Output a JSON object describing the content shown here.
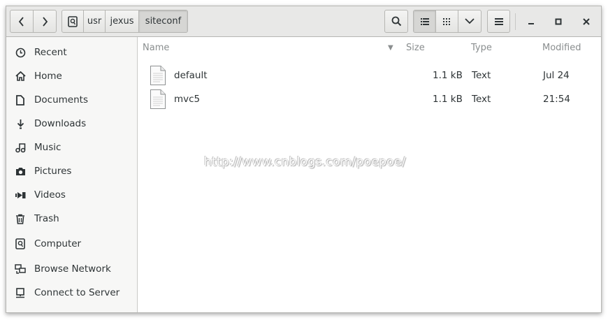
{
  "window": {
    "title": "siteconf"
  },
  "breadcrumb": {
    "root_icon": "drive-icon",
    "segments": [
      "usr",
      "jexus",
      "siteconf"
    ]
  },
  "toolbar": {
    "back_icon": "chevron-left-icon",
    "forward_icon": "chevron-right-icon",
    "search_icon": "search-icon",
    "list_view_icon": "list-view-icon",
    "grid_view_icon": "grid-view-icon",
    "view_options_icon": "chevron-down-icon",
    "menu_icon": "hamburger-icon"
  },
  "window_controls": {
    "minimize": "–",
    "maximize": "□",
    "close": "×"
  },
  "sidebar": {
    "items": [
      {
        "label": "Recent",
        "icon": "clock-icon"
      },
      {
        "label": "Home",
        "icon": "home-icon"
      },
      {
        "label": "Documents",
        "icon": "document-icon"
      },
      {
        "label": "Downloads",
        "icon": "download-icon"
      },
      {
        "label": "Music",
        "icon": "music-icon"
      },
      {
        "label": "Pictures",
        "icon": "camera-icon"
      },
      {
        "label": "Videos",
        "icon": "video-icon"
      },
      {
        "label": "Trash",
        "icon": "trash-icon"
      },
      {
        "label": "Computer",
        "icon": "computer-icon"
      },
      {
        "label": "Browse Network",
        "icon": "network-icon"
      },
      {
        "label": "Connect to Server",
        "icon": "server-icon"
      }
    ]
  },
  "file_list": {
    "columns": {
      "name": "Name",
      "size": "Size",
      "type": "Type",
      "modified": "Modified"
    },
    "sort_indicator": "▼",
    "rows": [
      {
        "name": "default",
        "size": "1.1 kB",
        "type": "Text",
        "modified": "Jul 24"
      },
      {
        "name": "mvc5",
        "size": "1.1 kB",
        "type": "Text",
        "modified": "21:54"
      }
    ]
  },
  "watermark": "http://www.cnblogs.com/poepoe/",
  "colors": {
    "header_bg": "#e8e8e7",
    "sidebar_bg": "#f7f7f6",
    "border": "#b6b6b3",
    "text": "#2e3436",
    "muted": "#8a8e8f"
  }
}
